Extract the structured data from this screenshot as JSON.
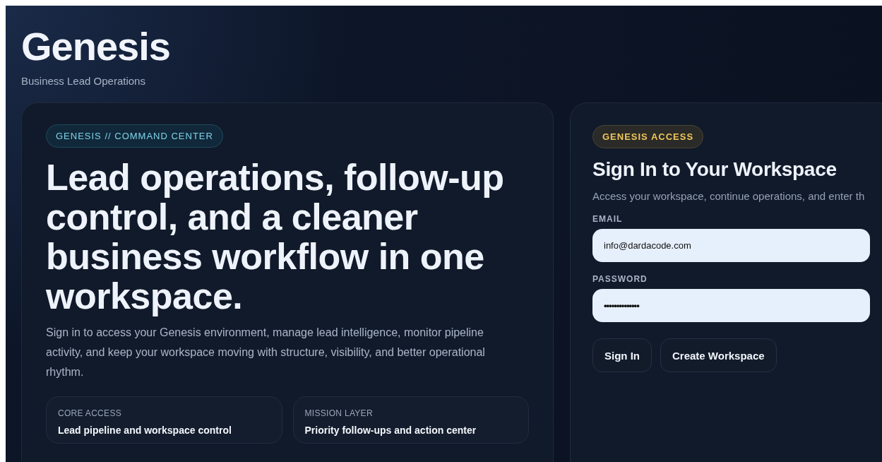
{
  "brand": {
    "title": "Genesis",
    "subtitle": "Business Lead Operations"
  },
  "hero": {
    "badge": "GENESIS // COMMAND CENTER",
    "headline": "Lead operations, follow-up control, and a cleaner business workflow in one workspace.",
    "description": "Sign in to access your Genesis environment, manage lead intelligence, monitor pipeline activity, and keep your workspace moving with structure, visibility, and better operational rhythm.",
    "features": [
      {
        "label": "CORE ACCESS",
        "title": "Lead pipeline and workspace control"
      },
      {
        "label": "MISSION LAYER",
        "title": "Priority follow-ups and action center"
      }
    ]
  },
  "access": {
    "badge": "GENESIS ACCESS",
    "title": "Sign In to Your Workspace",
    "description": "Access your workspace, continue operations, and enter th",
    "fields": [
      {
        "label": "EMAIL",
        "value": "info@dardacode.com",
        "kind": "text"
      },
      {
        "label": "PASSWORD",
        "value": "••••••••••••••",
        "kind": "password"
      }
    ],
    "buttons": [
      "Sign In",
      "Create Workspace"
    ]
  }
}
